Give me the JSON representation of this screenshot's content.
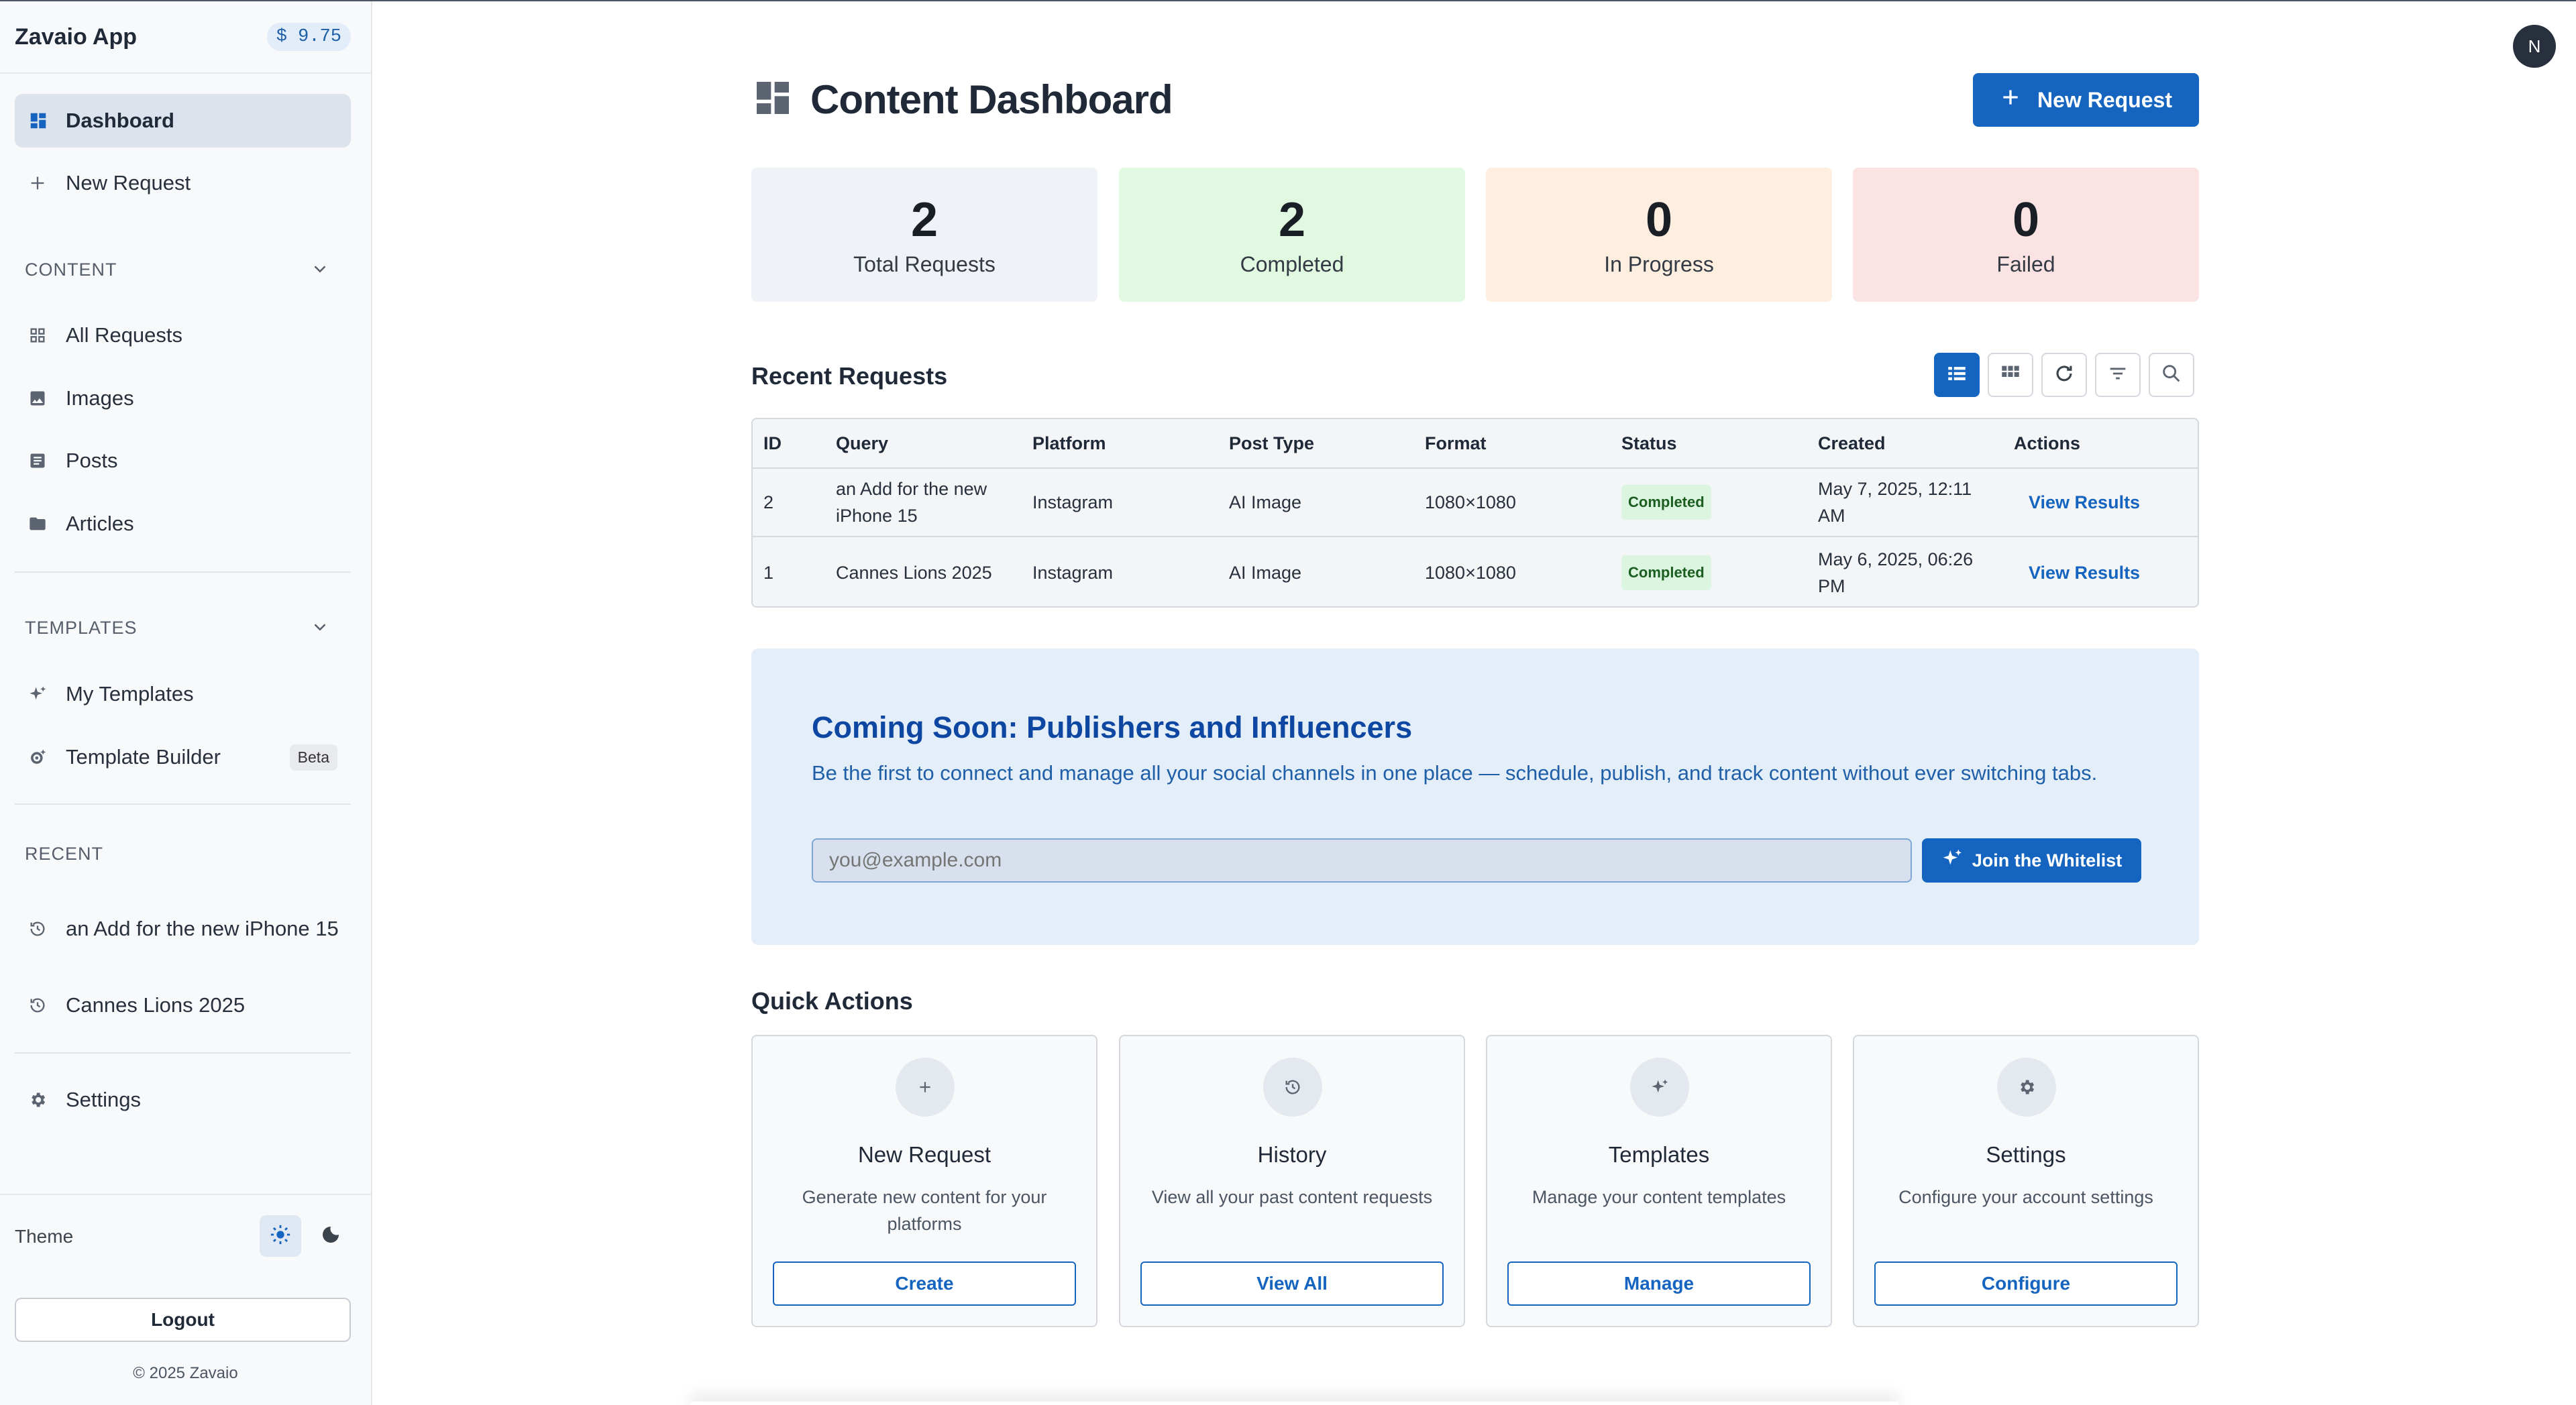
{
  "sidebar": {
    "app_name": "Zavaio App",
    "balance": "$ 9.75",
    "nav": {
      "dashboard": "Dashboard",
      "new_request": "New Request"
    },
    "content_section": {
      "label": "CONTENT",
      "items": [
        "All Requests",
        "Images",
        "Posts",
        "Articles"
      ]
    },
    "templates_section": {
      "label": "TEMPLATES",
      "items": [
        "My Templates",
        "Template Builder"
      ],
      "beta_badge": "Beta"
    },
    "recent_section": {
      "label": "RECENT",
      "items": [
        "an Add for the new iPhone 15",
        "Cannes Lions 2025"
      ]
    },
    "settings": "Settings",
    "theme_label": "Theme",
    "logout": "Logout",
    "copyright": "© 2025 Zavaio"
  },
  "header": {
    "avatar_initial": "N",
    "title": "Content Dashboard",
    "new_request_button": "New Request"
  },
  "stats": [
    {
      "value": "2",
      "label": "Total Requests",
      "color": "#eff2f6"
    },
    {
      "value": "2",
      "label": "Completed",
      "color": "#e1f8e1"
    },
    {
      "value": "0",
      "label": "In Progress",
      "color": "#fdeee0"
    },
    {
      "value": "0",
      "label": "Failed",
      "color": "#fbe3e3"
    }
  ],
  "recent_requests": {
    "title": "Recent Requests",
    "columns": [
      "ID",
      "Query",
      "Platform",
      "Post Type",
      "Format",
      "Status",
      "Created",
      "Actions"
    ],
    "rows": [
      {
        "id": "2",
        "query": "an Add for the new iPhone 15",
        "platform": "Instagram",
        "post_type": "AI Image",
        "format": "1080×1080",
        "status": "Completed",
        "created": "May 7, 2025, 12:11 AM",
        "action": "View Results"
      },
      {
        "id": "1",
        "query": "Cannes Lions 2025",
        "platform": "Instagram",
        "post_type": "AI Image",
        "format": "1080×1080",
        "status": "Completed",
        "created": "May 6, 2025, 06:26 PM",
        "action": "View Results"
      }
    ]
  },
  "promo": {
    "title": "Coming Soon: Publishers and Influencers",
    "description": "Be the first to connect and manage all your social channels in one place — schedule, publish, and track content without ever switching tabs.",
    "email_placeholder": "you@example.com",
    "button": "Join the Whitelist"
  },
  "quick_actions": {
    "title": "Quick Actions",
    "cards": [
      {
        "name": "New Request",
        "description": "Generate new content for your platforms",
        "button": "Create",
        "icon": "plus-icon"
      },
      {
        "name": "History",
        "description": "View all your past content requests",
        "button": "View All",
        "icon": "history-icon"
      },
      {
        "name": "Templates",
        "description": "Manage your content templates",
        "button": "Manage",
        "icon": "sparkle-icon"
      },
      {
        "name": "Settings",
        "description": "Configure your account settings",
        "button": "Configure",
        "icon": "gear-icon"
      }
    ]
  },
  "colors": {
    "accent": "#1565c0",
    "promo_bg": "#e4eef9"
  }
}
